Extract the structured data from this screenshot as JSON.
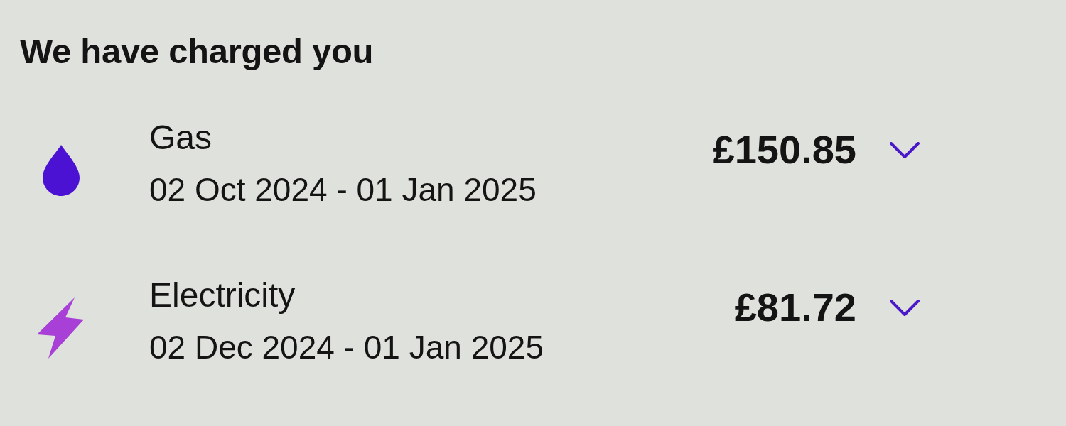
{
  "heading": "We have charged you",
  "charges": [
    {
      "kind": "gas",
      "color": "#4b12d4",
      "label": "Gas",
      "period": "02 Oct 2024 - 01 Jan 2025",
      "amount": "£150.85",
      "expanded": false
    },
    {
      "kind": "electricity",
      "color": "#a83fd6",
      "label": "Electricity",
      "period": "02 Dec 2024 - 01 Jan 2025",
      "amount": "£81.72",
      "expanded": false
    }
  ]
}
